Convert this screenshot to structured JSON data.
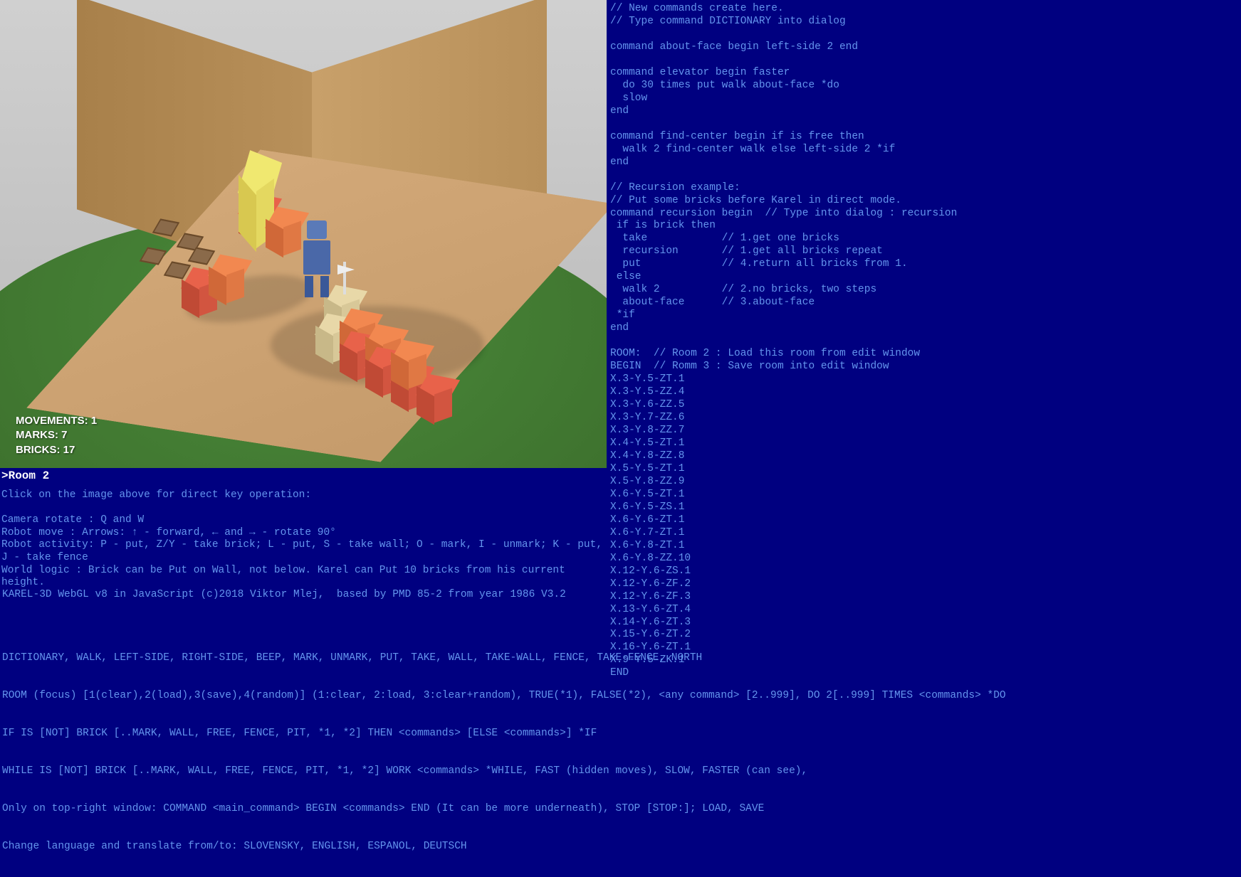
{
  "stats": {
    "movements_label": "MOVEMENTS:",
    "movements_value": "1",
    "marks_label": "MARKS:",
    "marks_value": "7",
    "bricks_label": "BRICKS:",
    "bricks_value": "17"
  },
  "console": {
    "prompt": ">Room 2",
    "hint": "Click on the image above for direct key operation:",
    "line_camera": "Camera rotate : Q and W",
    "line_move": "Robot move    : Arrows: ↑ - forward, ← and → - rotate 90°",
    "line_act": "Robot activity: P - put, Z/Y - take brick; L - put, S - take wall; O - mark, I - unmark; K - put, J - take fence",
    "line_logic": "World logic   : Brick can be Put on Wall, not below. Karel can Put 10 bricks from his current height."
  },
  "help": {
    "about": "KAREL-3D WebGL v8 in JavaScript (c)2018 Viktor Mlej,  based by PMD 85-2 from year 1986 V3.2",
    "line1": "DICTIONARY, WALK, LEFT-SIDE, RIGHT-SIDE, BEEP, MARK, UNMARK, PUT, TAKE, WALL, TAKE-WALL, FENCE, TAKE-FENCE, NORTH",
    "line2": "ROOM (focus) [1(clear),2(load),3(save),4(random)] (1:clear, 2:load, 3:clear+random), TRUE(*1), FALSE(*2), <any command> [2..999], DO 2[..999] TIMES <commands> *DO",
    "line3": "IF IS [NOT] BRICK [..MARK, WALL, FREE, FENCE, PIT, *1, *2] THEN <commands> [ELSE <commands>] *IF",
    "line4": "WHILE IS [NOT] BRICK [..MARK, WALL, FREE, FENCE, PIT, *1, *2] WORK <commands> *WHILE, FAST (hidden moves), SLOW, FASTER (can see),",
    "line5": "Only on top-right window: COMMAND <main_command> BEGIN <commands> END (It can be more underneath), STOP [STOP:]; LOAD, SAVE",
    "line6": "Change language and translate from/to: SLOVENSKY, ENGLISH, ESPANOL, DEUTSCH"
  },
  "code": "// New commands create here.\n// Type command DICTIONARY into dialog\n\ncommand about-face begin left-side 2 end\n\ncommand elevator begin faster\n  do 30 times put walk about-face *do\n  slow\nend\n\ncommand find-center begin if is free then\n  walk 2 find-center walk else left-side 2 *if\nend\n\n// Recursion example:\n// Put some bricks before Karel in direct mode.\ncommand recursion begin  // Type into dialog : recursion\n if is brick then\n  take            // 1.get one bricks\n  recursion       // 1.get all bricks repeat\n  put             // 4.return all bricks from 1.\n else\n  walk 2          // 2.no bricks, two steps\n  about-face      // 3.about-face\n *if\nend\n\nROOM:  // Room 2 : Load this room from edit window\nBEGIN  // Romm 3 : Save room into edit window\nX.3-Y.5-ZT.1\nX.3-Y.5-ZZ.4\nX.3-Y.6-ZZ.5\nX.3-Y.7-ZZ.6\nX.3-Y.8-ZZ.7\nX.4-Y.5-ZT.1\nX.4-Y.8-ZZ.8\nX.5-Y.5-ZT.1\nX.5-Y.8-ZZ.9\nX.6-Y.5-ZT.1\nX.6-Y.5-ZS.1\nX.6-Y.6-ZT.1\nX.6-Y.7-ZT.1\nX.6-Y.8-ZT.1\nX.6-Y.8-ZZ.10\nX.12-Y.6-ZS.1\nX.12-Y.6-ZF.2\nX.12-Y.6-ZF.3\nX.13-Y.6-ZT.4\nX.14-Y.6-ZT.3\nX.15-Y.6-ZT.2\nX.16-Y.6-ZT.1\nX.9-Y.5-ZK.1\nEND",
  "scene": {
    "robot": "karel-robot",
    "walls": [
      "wall-left",
      "wall-right"
    ],
    "marks_count": 7,
    "bricks_visible": 17
  }
}
